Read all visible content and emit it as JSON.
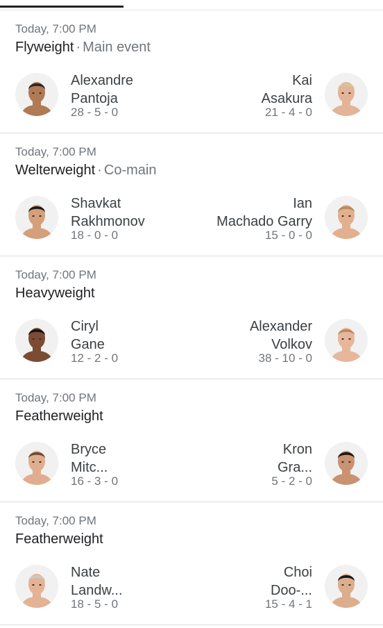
{
  "fights": [
    {
      "time": "Today, 7:00 PM",
      "weight": "Flyweight",
      "tag": "Main event",
      "left": {
        "first": "Alexandre",
        "last": "Pantoja",
        "record": "28 - 5 - 0"
      },
      "right": {
        "first": "Kai",
        "last": "Asakura",
        "record": "21 - 4 - 0"
      }
    },
    {
      "time": "Today, 7:00 PM",
      "weight": "Welterweight",
      "tag": "Co-main",
      "left": {
        "first": "Shavkat",
        "last": "Rakhmonov",
        "record": "18 - 0 - 0"
      },
      "right": {
        "first": "Ian",
        "last": "Machado Garry",
        "record": "15 - 0 - 0"
      }
    },
    {
      "time": "Today, 7:00 PM",
      "weight": "Heavyweight",
      "tag": "",
      "left": {
        "first": "Ciryl",
        "last": "Gane",
        "record": "12 - 2 - 0"
      },
      "right": {
        "first": "Alexander",
        "last": "Volkov",
        "record": "38 - 10 - 0"
      }
    },
    {
      "time": "Today, 7:00 PM",
      "weight": "Featherweight",
      "tag": "",
      "left": {
        "first": "Bryce",
        "last": "Mitc...",
        "record": "16 - 3 - 0"
      },
      "right": {
        "first": "Kron",
        "last": "Gra...",
        "record": "5 - 2 - 0"
      }
    },
    {
      "time": "Today, 7:00 PM",
      "weight": "Featherweight",
      "tag": "",
      "left": {
        "first": "Nate",
        "last": "Landw...",
        "record": "18 - 5 - 0"
      },
      "right": {
        "first": "Choi",
        "last": "Doo-...",
        "record": "15 - 4 - 1"
      }
    }
  ],
  "colors": {
    "skin": [
      "#b07a55",
      "#e3b497",
      "#d4a07c",
      "#e2b08f",
      "#7a4c33",
      "#e6b79b",
      "#e0ae8f",
      "#c99272",
      "#e3b396",
      "#dcae8d"
    ],
    "hair": [
      "#2b2521",
      "#d9c29b",
      "#1c1a18",
      "#b78b5c",
      "#161412",
      "#b88a5a",
      "#6b4a33",
      "#1a1614",
      "#cfc8bf",
      "#181614"
    ]
  },
  "icons": {
    "avatar": "fighter-headshot-icon"
  }
}
